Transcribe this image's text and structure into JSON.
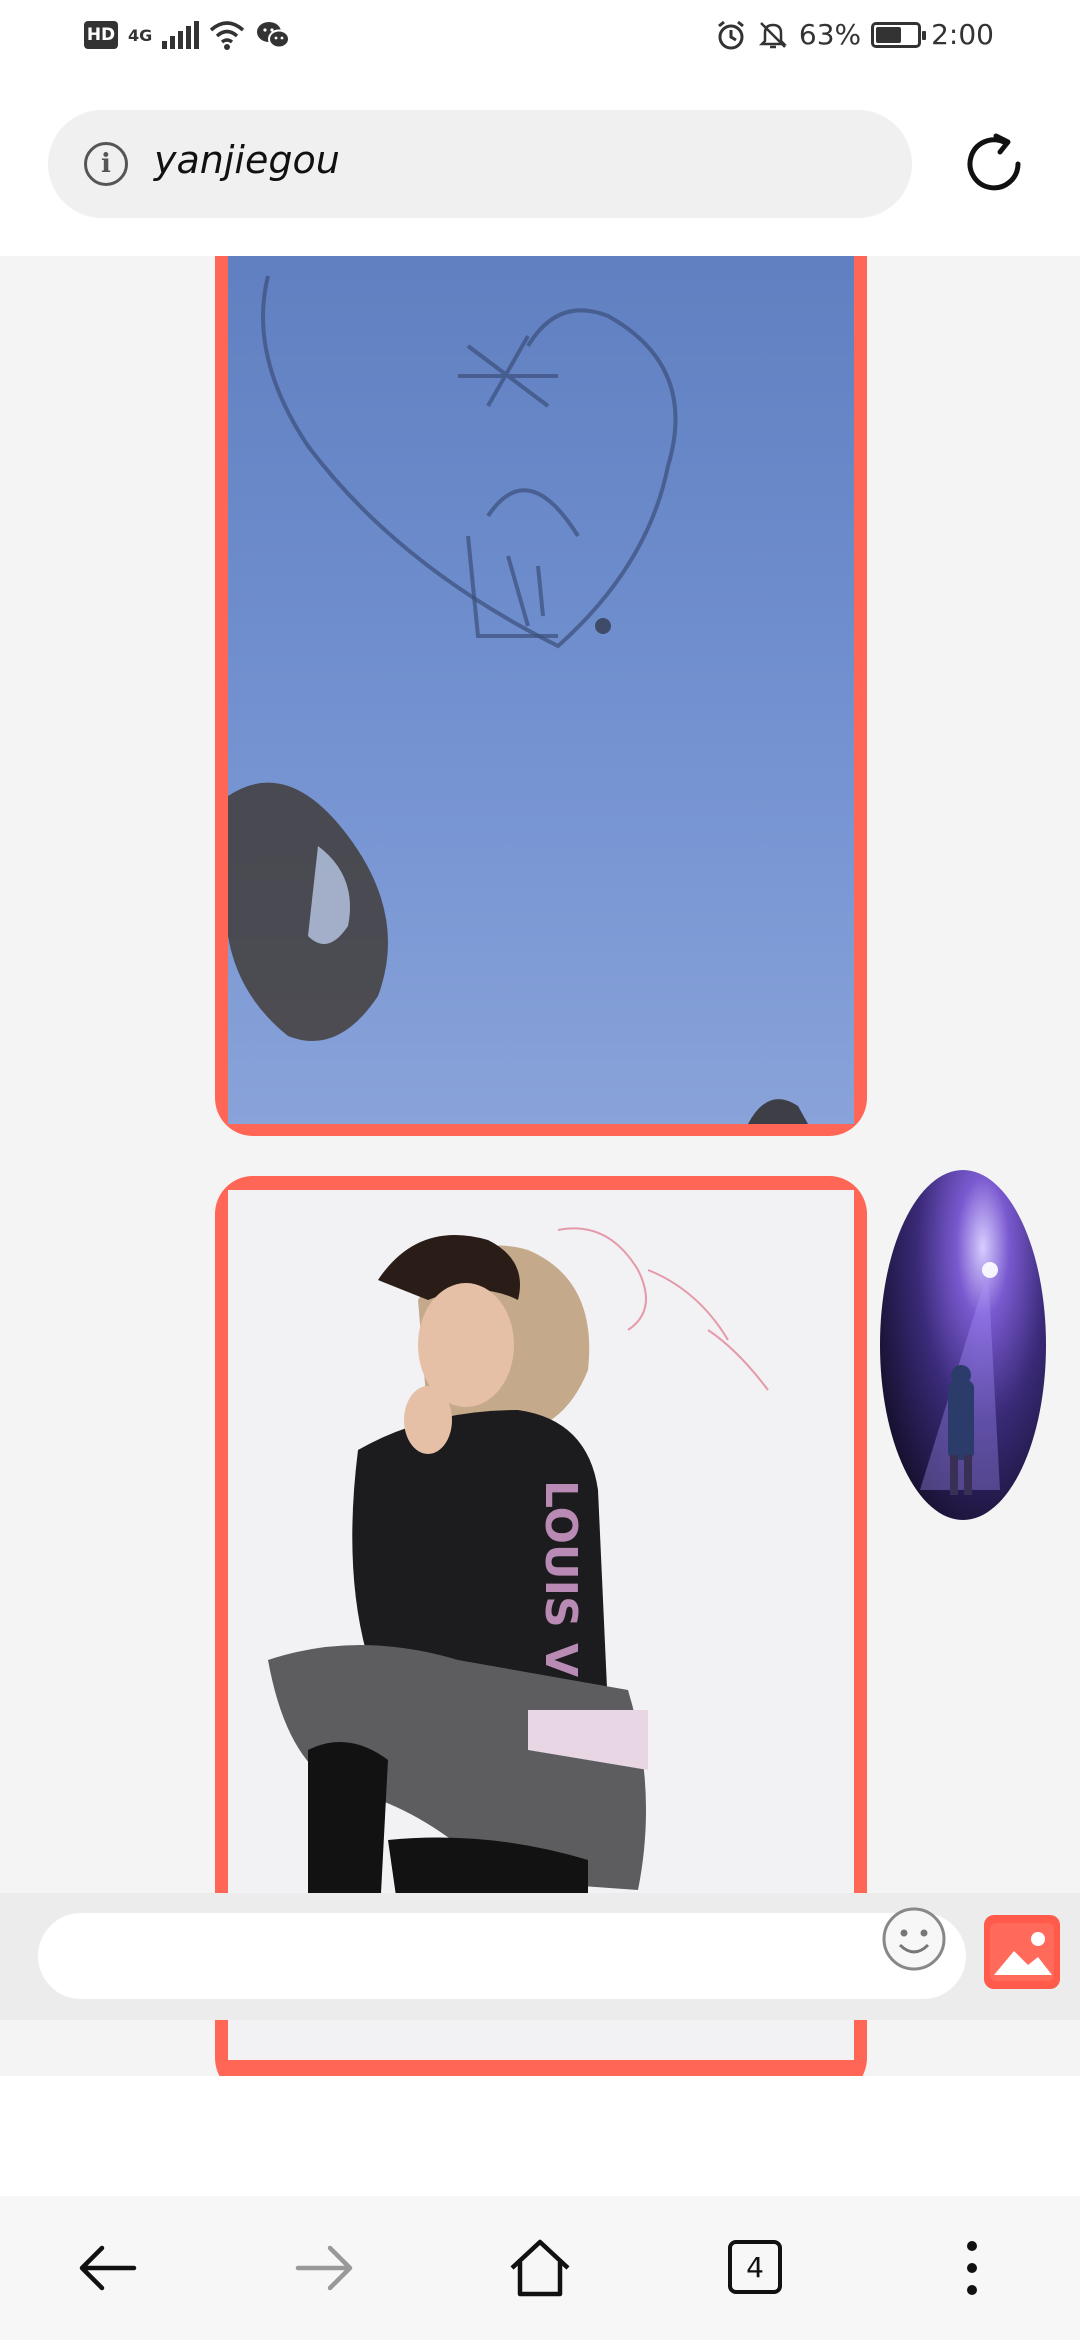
{
  "status_bar": {
    "hd": "HD",
    "network": "4G",
    "battery_percent": "63%",
    "battery_level": 0.63,
    "time": "2:00"
  },
  "url_bar": {
    "url": "yanjiegou"
  },
  "messages": [
    {
      "type": "image",
      "subject": "heart drawn in snow with characters"
    },
    {
      "type": "image",
      "subject": "man in hoodie sitting pose"
    }
  ],
  "sender_avatar": {
    "subject": "figure under spotlight"
  },
  "input": {
    "placeholder": ""
  },
  "navigation": {
    "tab_count": "4"
  },
  "colors": {
    "frame_accent": "#ff6655",
    "image_button": "#ff5a4a"
  }
}
